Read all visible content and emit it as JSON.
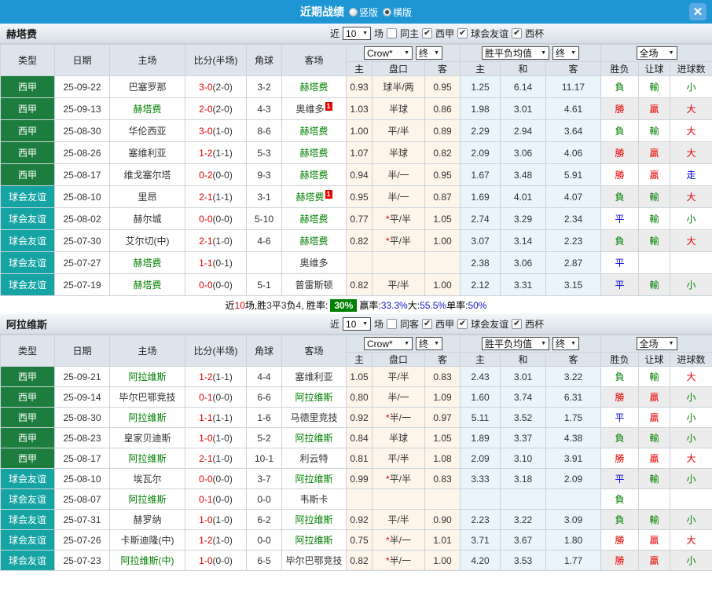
{
  "titlebar": {
    "title": "近期战绩",
    "radio_vertical": "竖版",
    "radio_horizontal": "横版",
    "close_icon": "✕"
  },
  "colors": {
    "titlebar_blue": "#1e96d4",
    "league_green": "#1d7d3e",
    "friendly_teal": "#16a3a3",
    "win_red": "#e60000",
    "loss_green": "#008000",
    "draw_blue": "#0000d8",
    "rate_badge_green": "#008000"
  },
  "table_header": {
    "main_columns": [
      "类型",
      "日期",
      "主场",
      "比分(半场)",
      "角球",
      "客场"
    ],
    "sub_columns": [
      "主",
      "盘口",
      "客",
      "主",
      "和",
      "客",
      "胜负",
      "让球",
      "进球数"
    ],
    "selects": {
      "odds_source": "Crow*",
      "odds_final": "终",
      "avg": "胜平负均值",
      "avg_final": "终",
      "scope": "全场"
    }
  },
  "controls": {
    "near": "近",
    "count": "10",
    "games": "场"
  },
  "sections": [
    {
      "team": "赫塔费",
      "same_checkbox": {
        "label": "同主",
        "checked": false
      },
      "league_checkboxes": [
        {
          "label": "西甲",
          "checked": true
        },
        {
          "label": "球会友谊",
          "checked": true
        },
        {
          "label": "西杯",
          "checked": true
        }
      ],
      "rows": [
        {
          "type": "西甲",
          "date": "25-09-22",
          "home": "巴塞罗那",
          "home_green": false,
          "home_badge": "",
          "score": "3-0",
          "half": "(2-0)",
          "corner": "3-2",
          "away": "赫塔费",
          "away_green": true,
          "away_badge": "",
          "odds_home": "0.93",
          "handicap": "球半/两",
          "odds_away": "0.95",
          "avg_home": "1.25",
          "avg_draw": "6.14",
          "avg_away": "11.17",
          "res_wdl": "負",
          "res_handicap": "輸",
          "res_goals": "小"
        },
        {
          "type": "西甲",
          "date": "25-09-13",
          "home": "赫塔费",
          "home_green": true,
          "home_badge": "",
          "score": "2-0",
          "half": "(2-0)",
          "corner": "4-3",
          "away": "奥维多",
          "away_green": false,
          "away_badge": "1",
          "odds_home": "1.03",
          "handicap": "半球",
          "odds_away": "0.86",
          "avg_home": "1.98",
          "avg_draw": "3.01",
          "avg_away": "4.61",
          "res_wdl": "勝",
          "res_handicap": "贏",
          "res_goals": "大"
        },
        {
          "type": "西甲",
          "date": "25-08-30",
          "home": "华伦西亚",
          "home_green": false,
          "home_badge": "",
          "score": "3-0",
          "half": "(1-0)",
          "corner": "8-6",
          "away": "赫塔费",
          "away_green": true,
          "away_badge": "",
          "odds_home": "1.00",
          "handicap": "平/半",
          "odds_away": "0.89",
          "avg_home": "2.29",
          "avg_draw": "2.94",
          "avg_away": "3.64",
          "res_wdl": "負",
          "res_handicap": "輸",
          "res_goals": "大"
        },
        {
          "type": "西甲",
          "date": "25-08-26",
          "home": "塞维利亚",
          "home_green": false,
          "home_badge": "",
          "score": "1-2",
          "half": "(1-1)",
          "corner": "5-3",
          "away": "赫塔费",
          "away_green": true,
          "away_badge": "",
          "odds_home": "1.07",
          "handicap": "半球",
          "odds_away": "0.82",
          "avg_home": "2.09",
          "avg_draw": "3.06",
          "avg_away": "4.06",
          "res_wdl": "勝",
          "res_handicap": "贏",
          "res_goals": "大"
        },
        {
          "type": "西甲",
          "date": "25-08-17",
          "home": "维戈塞尔塔",
          "home_green": false,
          "home_badge": "",
          "score": "0-2",
          "half": "(0-0)",
          "corner": "9-3",
          "away": "赫塔费",
          "away_green": true,
          "away_badge": "",
          "odds_home": "0.94",
          "handicap": "半/一",
          "odds_away": "0.95",
          "avg_home": "1.67",
          "avg_draw": "3.48",
          "avg_away": "5.91",
          "res_wdl": "勝",
          "res_handicap": "贏",
          "res_goals": "走"
        },
        {
          "type": "球会友谊",
          "date": "25-08-10",
          "home": "里昂",
          "home_green": false,
          "home_badge": "",
          "score": "2-1",
          "half": "(1-1)",
          "corner": "3-1",
          "away": "赫塔费",
          "away_green": true,
          "away_badge": "1",
          "odds_home": "0.95",
          "handicap": "半/一",
          "odds_away": "0.87",
          "avg_home": "1.69",
          "avg_draw": "4.01",
          "avg_away": "4.07",
          "res_wdl": "負",
          "res_handicap": "輸",
          "res_goals": "大"
        },
        {
          "type": "球会友谊",
          "date": "25-08-02",
          "home": "赫尔城",
          "home_green": false,
          "home_badge": "",
          "score": "0-0",
          "half": "(0-0)",
          "corner": "5-10",
          "away": "赫塔费",
          "away_green": true,
          "away_badge": "",
          "odds_home": "0.77",
          "handicap": "*平/半",
          "odds_away": "1.05",
          "avg_home": "2.74",
          "avg_draw": "3.29",
          "avg_away": "2.34",
          "res_wdl": "平",
          "res_handicap": "輸",
          "res_goals": "小"
        },
        {
          "type": "球会友谊",
          "date": "25-07-30",
          "home": "艾尔切(中)",
          "home_green": false,
          "home_badge": "",
          "score": "2-1",
          "half": "(1-0)",
          "corner": "4-6",
          "away": "赫塔费",
          "away_green": true,
          "away_badge": "",
          "odds_home": "0.82",
          "handicap": "*平/半",
          "odds_away": "1.00",
          "avg_home": "3.07",
          "avg_draw": "3.14",
          "avg_away": "2.23",
          "res_wdl": "負",
          "res_handicap": "輸",
          "res_goals": "大"
        },
        {
          "type": "球会友谊",
          "date": "25-07-27",
          "home": "赫塔费",
          "home_green": true,
          "home_badge": "",
          "score": "1-1",
          "half": "(0-1)",
          "corner": "",
          "away": "奥维多",
          "away_green": false,
          "away_badge": "",
          "odds_home": "",
          "handicap": "",
          "odds_away": "",
          "avg_home": "2.38",
          "avg_draw": "3.06",
          "avg_away": "2.87",
          "res_wdl": "平",
          "res_handicap": "",
          "res_goals": ""
        },
        {
          "type": "球会友谊",
          "date": "25-07-19",
          "home": "赫塔费",
          "home_green": true,
          "home_badge": "",
          "score": "0-0",
          "half": "(0-0)",
          "corner": "5-1",
          "away": "普雷斯顿",
          "away_green": false,
          "away_badge": "",
          "odds_home": "0.82",
          "handicap": "平/半",
          "odds_away": "1.00",
          "avg_home": "2.12",
          "avg_draw": "3.31",
          "avg_away": "3.15",
          "res_wdl": "平",
          "res_handicap": "輸",
          "res_goals": "小"
        }
      ],
      "summary": [
        {
          "text": "近",
          "style": "plain"
        },
        {
          "text": "10",
          "style": "red"
        },
        {
          "text": "场,胜",
          "style": "plain"
        },
        {
          "text": "3",
          "style": "dark"
        },
        {
          "text": "平",
          "style": "plain"
        },
        {
          "text": "3",
          "style": "dark"
        },
        {
          "text": "负",
          "style": "plain"
        },
        {
          "text": "4",
          "style": "dark"
        },
        {
          "text": ", 胜率:",
          "style": "plain"
        },
        {
          "text": "30%",
          "style": "green-badge"
        },
        {
          "text": "赢率:",
          "style": "plain"
        },
        {
          "text": "33.3%",
          "style": "blue"
        },
        {
          "text": " 大:",
          "style": "plain"
        },
        {
          "text": "55.5%",
          "style": "blue"
        },
        {
          "text": " 单率:",
          "style": "plain"
        },
        {
          "text": "50%",
          "style": "blue"
        }
      ]
    },
    {
      "team": "阿拉维斯",
      "same_checkbox": {
        "label": "同客",
        "checked": false
      },
      "league_checkboxes": [
        {
          "label": "西甲",
          "checked": true
        },
        {
          "label": "球会友谊",
          "checked": true
        },
        {
          "label": "西杯",
          "checked": true
        }
      ],
      "rows": [
        {
          "type": "西甲",
          "date": "25-09-21",
          "home": "阿拉维斯",
          "home_green": true,
          "home_badge": "",
          "score": "1-2",
          "half": "(1-1)",
          "corner": "4-4",
          "away": "塞维利亚",
          "away_green": false,
          "away_badge": "",
          "odds_home": "1.05",
          "handicap": "平/半",
          "odds_away": "0.83",
          "avg_home": "2.43",
          "avg_draw": "3.01",
          "avg_away": "3.22",
          "res_wdl": "負",
          "res_handicap": "輸",
          "res_goals": "大"
        },
        {
          "type": "西甲",
          "date": "25-09-14",
          "home": "毕尔巴鄂竞技",
          "home_green": false,
          "home_badge": "",
          "score": "0-1",
          "half": "(0-0)",
          "corner": "6-6",
          "away": "阿拉维斯",
          "away_green": true,
          "away_badge": "",
          "odds_home": "0.80",
          "handicap": "半/一",
          "odds_away": "1.09",
          "avg_home": "1.60",
          "avg_draw": "3.74",
          "avg_away": "6.31",
          "res_wdl": "勝",
          "res_handicap": "贏",
          "res_goals": "小"
        },
        {
          "type": "西甲",
          "date": "25-08-30",
          "home": "阿拉维斯",
          "home_green": true,
          "home_badge": "",
          "score": "1-1",
          "half": "(1-1)",
          "corner": "1-6",
          "away": "马德里竞技",
          "away_green": false,
          "away_badge": "",
          "odds_home": "0.92",
          "handicap": "*半/一",
          "odds_away": "0.97",
          "avg_home": "5.11",
          "avg_draw": "3.52",
          "avg_away": "1.75",
          "res_wdl": "平",
          "res_handicap": "贏",
          "res_goals": "小"
        },
        {
          "type": "西甲",
          "date": "25-08-23",
          "home": "皇家贝迪斯",
          "home_green": false,
          "home_badge": "",
          "score": "1-0",
          "half": "(1-0)",
          "corner": "5-2",
          "away": "阿拉维斯",
          "away_green": true,
          "away_badge": "",
          "odds_home": "0.84",
          "handicap": "半球",
          "odds_away": "1.05",
          "avg_home": "1.89",
          "avg_draw": "3.37",
          "avg_away": "4.38",
          "res_wdl": "負",
          "res_handicap": "輸",
          "res_goals": "小"
        },
        {
          "type": "西甲",
          "date": "25-08-17",
          "home": "阿拉维斯",
          "home_green": true,
          "home_badge": "",
          "score": "2-1",
          "half": "(1-0)",
          "corner": "10-1",
          "away": "利云特",
          "away_green": false,
          "away_badge": "",
          "odds_home": "0.81",
          "handicap": "平/半",
          "odds_away": "1.08",
          "avg_home": "2.09",
          "avg_draw": "3.10",
          "avg_away": "3.91",
          "res_wdl": "勝",
          "res_handicap": "贏",
          "res_goals": "大"
        },
        {
          "type": "球会友谊",
          "date": "25-08-10",
          "home": "埃瓦尔",
          "home_green": false,
          "home_badge": "",
          "score": "0-0",
          "half": "(0-0)",
          "corner": "3-7",
          "away": "阿拉维斯",
          "away_green": true,
          "away_badge": "",
          "odds_home": "0.99",
          "handicap": "*平/半",
          "odds_away": "0.83",
          "avg_home": "3.33",
          "avg_draw": "3.18",
          "avg_away": "2.09",
          "res_wdl": "平",
          "res_handicap": "輸",
          "res_goals": "小"
        },
        {
          "type": "球会友谊",
          "date": "25-08-07",
          "home": "阿拉维斯",
          "home_green": true,
          "home_badge": "",
          "score": "0-1",
          "half": "(0-0)",
          "corner": "0-0",
          "away": "韦斯卡",
          "away_green": false,
          "away_badge": "",
          "odds_home": "",
          "handicap": "",
          "odds_away": "",
          "avg_home": "",
          "avg_draw": "",
          "avg_away": "",
          "res_wdl": "負",
          "res_handicap": "",
          "res_goals": ""
        },
        {
          "type": "球会友谊",
          "date": "25-07-31",
          "home": "赫罗纳",
          "home_green": false,
          "home_badge": "",
          "score": "1-0",
          "half": "(1-0)",
          "corner": "6-2",
          "away": "阿拉维斯",
          "away_green": true,
          "away_badge": "",
          "odds_home": "0.92",
          "handicap": "平/半",
          "odds_away": "0.90",
          "avg_home": "2.23",
          "avg_draw": "3.22",
          "avg_away": "3.09",
          "res_wdl": "負",
          "res_handicap": "輸",
          "res_goals": "小"
        },
        {
          "type": "球会友谊",
          "date": "25-07-26",
          "home": "卡斯迪隆(中)",
          "home_green": false,
          "home_badge": "",
          "score": "1-2",
          "half": "(1-0)",
          "corner": "0-0",
          "away": "阿拉维斯",
          "away_green": true,
          "away_badge": "",
          "odds_home": "0.75",
          "handicap": "*半/一",
          "odds_away": "1.01",
          "avg_home": "3.71",
          "avg_draw": "3.67",
          "avg_away": "1.80",
          "res_wdl": "勝",
          "res_handicap": "贏",
          "res_goals": "大"
        },
        {
          "type": "球会友谊",
          "date": "25-07-23",
          "home": "阿拉维斯(中)",
          "home_green": true,
          "home_badge": "",
          "score": "1-0",
          "half": "(0-0)",
          "corner": "6-5",
          "away": "毕尔巴鄂竞技",
          "away_green": false,
          "away_badge": "",
          "odds_home": "0.82",
          "handicap": "*半/一",
          "odds_away": "1.00",
          "avg_home": "4.20",
          "avg_draw": "3.53",
          "avg_away": "1.77",
          "res_wdl": "勝",
          "res_handicap": "贏",
          "res_goals": "小"
        }
      ],
      "summary": null
    }
  ]
}
